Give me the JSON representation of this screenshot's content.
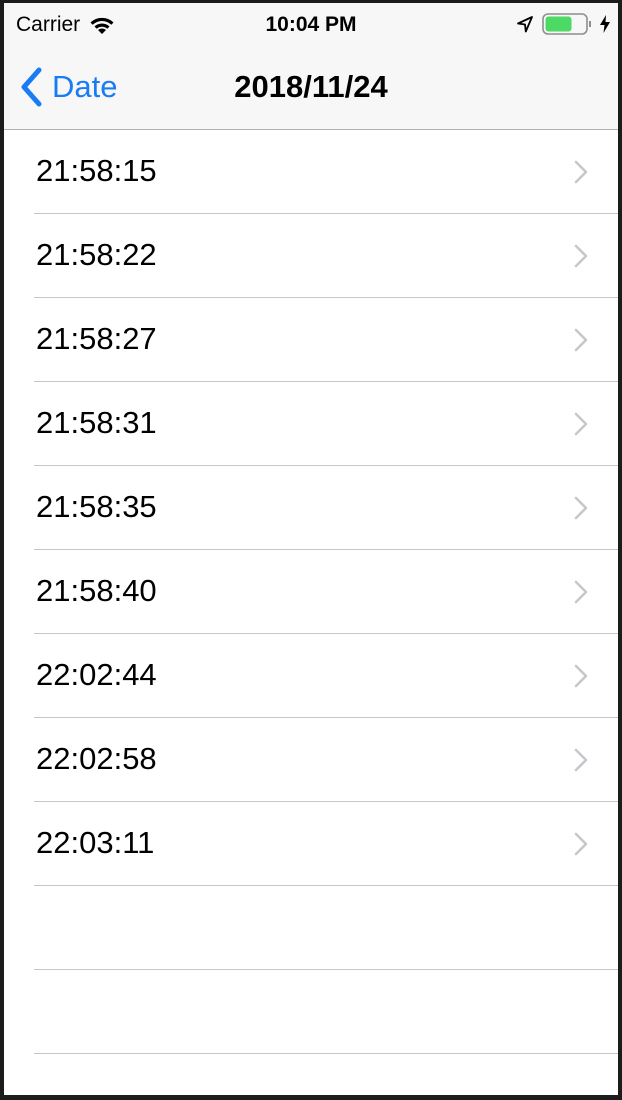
{
  "status_bar": {
    "carrier": "Carrier",
    "time": "10:04 PM",
    "battery_color": "#4cd964"
  },
  "nav": {
    "back_label": "Date",
    "title": "2018/11/24",
    "accent_color": "#1a7cf5"
  },
  "rows": [
    {
      "label": "21:58:15"
    },
    {
      "label": "21:58:22"
    },
    {
      "label": "21:58:27"
    },
    {
      "label": "21:58:31"
    },
    {
      "label": "21:58:35"
    },
    {
      "label": "21:58:40"
    },
    {
      "label": "22:02:44"
    },
    {
      "label": "22:02:58"
    },
    {
      "label": "22:03:11"
    }
  ],
  "icons": {
    "row_accessory": "chevron-right-icon",
    "back": "chevron-left-icon"
  }
}
